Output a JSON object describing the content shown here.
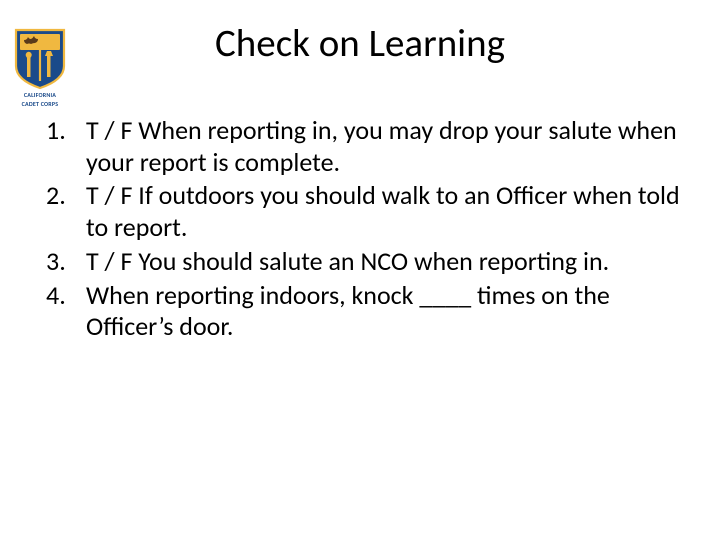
{
  "logo": {
    "line1": "CALIFORNIA",
    "line2": "CADET CORPS",
    "shield_blue": "#1a4a8a",
    "shield_gold": "#f0b840"
  },
  "title": "Check on Learning",
  "questions": [
    "T / F When reporting in, you may drop your salute when your report is complete.",
    "T / F If outdoors you should walk to an Officer when told to report.",
    "T / F You should salute an NCO when reporting in.",
    "When reporting indoors, knock ____ times on the Officer’s door."
  ]
}
